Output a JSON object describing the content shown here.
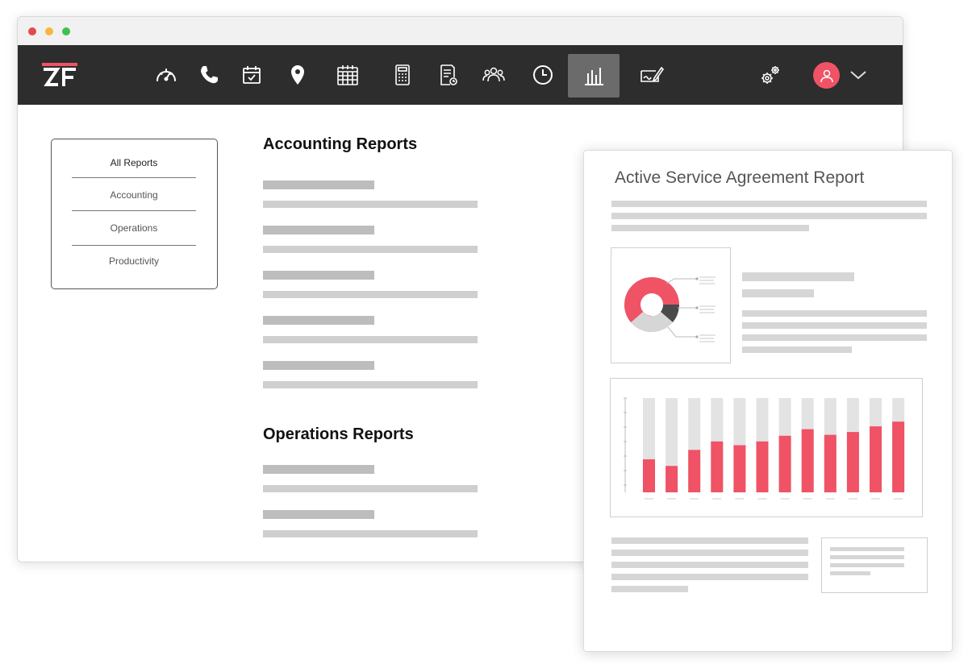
{
  "window": {
    "traffic_lights": [
      "#e5484d",
      "#f5b83d",
      "#3fc24c"
    ]
  },
  "navbar": {
    "logo_text": "ZF",
    "accent": "#ef5365",
    "icons": [
      "speedometer-icon",
      "phone-icon",
      "calendar-check-icon",
      "location-pin-icon",
      "calendar-grid-icon",
      "calculator-icon",
      "invoice-icon",
      "team-icon",
      "clock-icon",
      "bar-chart-icon",
      "check-sign-icon",
      "settings-gears-icon",
      "user-avatar-icon",
      "chevron-down-icon"
    ],
    "active_icon": "bar-chart-icon"
  },
  "sidebar": {
    "items": [
      {
        "label": "All Reports",
        "selected": true
      },
      {
        "label": "Accounting",
        "selected": false
      },
      {
        "label": "Operations",
        "selected": false
      },
      {
        "label": "Productivity",
        "selected": false
      }
    ]
  },
  "main": {
    "sections": [
      {
        "title": "Accounting Reports"
      },
      {
        "title": "Operations Reports"
      }
    ]
  },
  "report": {
    "title": "Active Service Agreement Report",
    "donut": {
      "red": 0.5,
      "dark": 0.1,
      "light": 0.4
    },
    "bar_colors": {
      "fill": "#ef5365",
      "track": "#e3e3e3"
    },
    "bars": [
      0.35,
      0.28,
      0.45,
      0.54,
      0.5,
      0.54,
      0.6,
      0.67,
      0.61,
      0.64,
      0.7,
      0.75
    ]
  }
}
